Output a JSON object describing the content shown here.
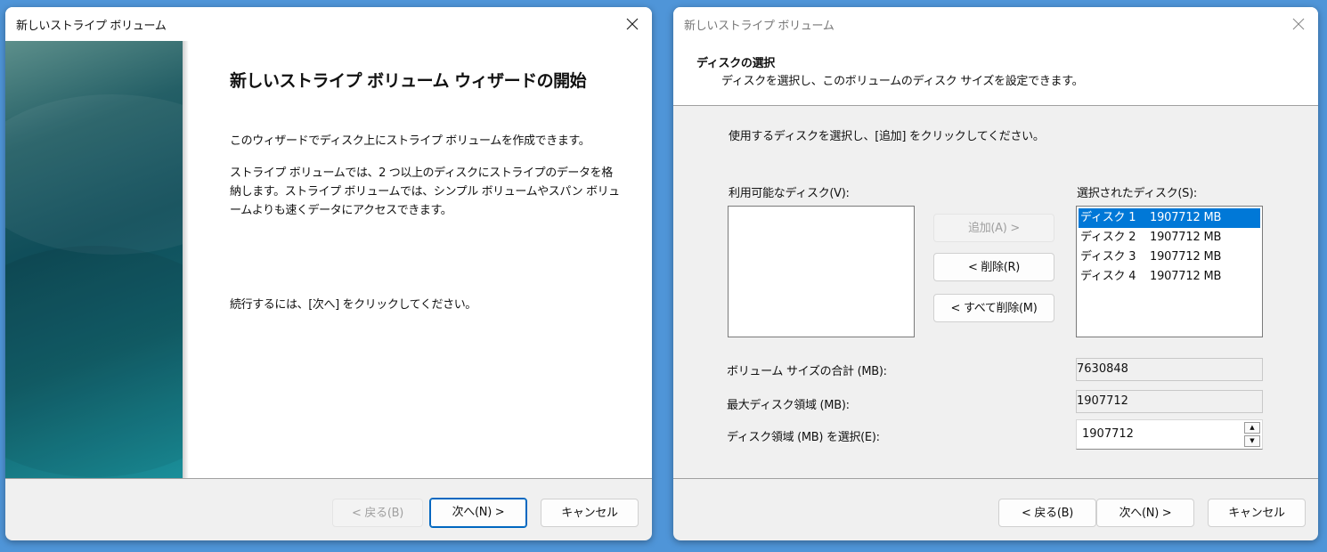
{
  "window1": {
    "title": "新しいストライプ ボリューム",
    "heading": "新しいストライプ ボリューム ウィザードの開始",
    "para1": "このウィザードでディスク上にストライプ ボリュームを作成できます。",
    "para2": "ストライプ ボリュームでは、2 つ以上のディスクにストライプのデータを格納します。ストライプ ボリュームでは、シンプル ボリュームやスパン ボリュームよりも速くデータにアクセスできます。",
    "para3": "続行するには、[次へ] をクリックしてください。",
    "buttons": {
      "back": "< 戻る(B)",
      "next": "次へ(N) >",
      "cancel": "キャンセル"
    }
  },
  "window2": {
    "title": "新しいストライプ ボリューム",
    "header_title": "ディスクの選択",
    "header_sub": "ディスクを選択し、このボリュームのディスク サイズを設定できます。",
    "instruction": "使用するディスクを選択し、[追加] をクリックしてください。",
    "available_label": "利用可能なディスク(V):",
    "available_items": [],
    "selected_label": "選択されたディスク(S):",
    "selected_items": [
      "ディスク 1    1907712 MB",
      "ディスク 2    1907712 MB",
      "ディスク 3    1907712 MB",
      "ディスク 4    1907712 MB"
    ],
    "selected_index": 0,
    "add_button": "追加(A) >",
    "remove_button": "< 削除(R)",
    "remove_all_button": "< すべて削除(M)",
    "total_label": "ボリューム サイズの合計 (MB):",
    "total_value": "7630848",
    "max_label": "最大ディスク領域 (MB):",
    "max_value": "1907712",
    "select_label": "ディスク領域 (MB) を選択(E):",
    "select_value": "1907712",
    "buttons": {
      "back": "< 戻る(B)",
      "next": "次へ(N) >",
      "cancel": "キャンセル"
    }
  },
  "colors": {
    "selection": "#0078d7",
    "default_button_border": "#0067c0",
    "background": "#4f95d8"
  }
}
